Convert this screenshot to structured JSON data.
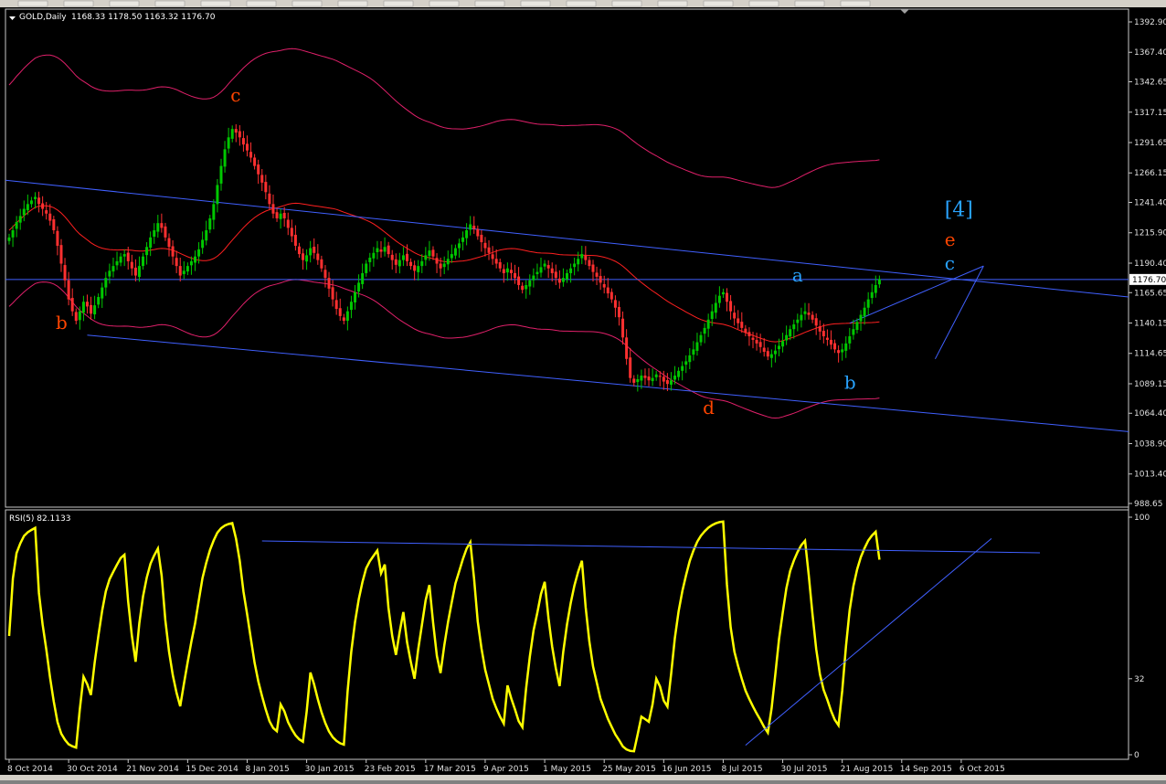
{
  "window": {
    "symbol_header": "GOLD,Daily",
    "ohlc_header": "1168.33 1178.50 1163.32 1176.70",
    "rsi_header": "RSI(5) 82.1133"
  },
  "chart_data": [
    {
      "type": "candlestick",
      "symbol": "GOLD",
      "timeframe": "Daily",
      "ohlc_last": {
        "open": 1168.33,
        "high": 1178.5,
        "low": 1163.32,
        "close": 1176.7
      },
      "ylim": [
        988.65,
        1392.9
      ],
      "y_ticks": [
        "1392.90",
        "1367.40",
        "1342.65",
        "1317.15",
        "1291.65",
        "1266.15",
        "1241.40",
        "1215.90",
        "1190.40",
        "1165.65",
        "1140.15",
        "1114.65",
        "1089.15",
        "1064.40",
        "1038.90",
        "1013.40",
        "988.65"
      ],
      "y_tick_values": [
        1392.9,
        1367.4,
        1342.65,
        1317.15,
        1291.65,
        1266.15,
        1241.4,
        1215.9,
        1190.4,
        1165.65,
        1140.15,
        1114.65,
        1089.15,
        1064.4,
        1038.9,
        1013.4,
        988.65
      ],
      "current_price_label": "1176.70",
      "current_price": 1176.7,
      "x_ticks": [
        "8 Oct 2014",
        "30 Oct 2014",
        "21 Nov 2014",
        "15 Dec 2014",
        "8 Jan 2015",
        "30 Jan 2015",
        "23 Feb 2015",
        "17 Mar 2015",
        "9 Apr 2015",
        "1 May 2015",
        "25 May 2015",
        "16 Jun 2015",
        "8 Jul 2015",
        "30 Jul 2015",
        "21 Aug 2015",
        "14 Sep 2015",
        "6 Oct 2015"
      ],
      "x_tick_index": [
        0,
        16,
        32,
        48,
        64,
        80,
        96,
        112,
        128,
        144,
        160,
        176,
        192,
        208,
        224,
        240,
        256
      ],
      "close_series": [
        1212,
        1218,
        1225,
        1230,
        1236,
        1240,
        1243,
        1246,
        1240,
        1236,
        1232,
        1226,
        1218,
        1205,
        1190,
        1176,
        1160,
        1150,
        1142,
        1150,
        1158,
        1154,
        1148,
        1155,
        1162,
        1170,
        1178,
        1184,
        1188,
        1192,
        1196,
        1198,
        1192,
        1186,
        1180,
        1188,
        1196,
        1204,
        1212,
        1218,
        1224,
        1220,
        1212,
        1204,
        1196,
        1188,
        1180,
        1184,
        1188,
        1192,
        1196,
        1202,
        1210,
        1218,
        1228,
        1240,
        1256,
        1272,
        1286,
        1296,
        1303,
        1300,
        1296,
        1290,
        1285,
        1279,
        1272,
        1265,
        1258,
        1250,
        1240,
        1232,
        1228,
        1232,
        1228,
        1220,
        1213,
        1205,
        1198,
        1193,
        1197,
        1203,
        1199,
        1193,
        1186,
        1178,
        1169,
        1160,
        1152,
        1146,
        1142,
        1150,
        1158,
        1166,
        1174,
        1182,
        1190,
        1195,
        1199,
        1203,
        1200,
        1204,
        1198,
        1193,
        1189,
        1193,
        1197,
        1192,
        1188,
        1184,
        1188,
        1192,
        1197,
        1201,
        1196,
        1190,
        1186,
        1190,
        1194,
        1198,
        1203,
        1207,
        1212,
        1218,
        1223,
        1219,
        1213,
        1208,
        1203,
        1199,
        1194,
        1190,
        1186,
        1182,
        1186,
        1182,
        1178,
        1172,
        1168,
        1172,
        1176,
        1180,
        1183,
        1187,
        1190,
        1186,
        1182,
        1178,
        1174,
        1178,
        1182,
        1186,
        1190,
        1194,
        1198,
        1193,
        1188,
        1183,
        1179,
        1174,
        1170,
        1165,
        1160,
        1153,
        1145,
        1128,
        1110,
        1094,
        1090,
        1093,
        1096,
        1094,
        1092,
        1094,
        1097,
        1095,
        1091,
        1089,
        1092,
        1096,
        1100,
        1104,
        1108,
        1113,
        1118,
        1124,
        1130,
        1136,
        1143,
        1150,
        1157,
        1163,
        1166,
        1158,
        1150,
        1144,
        1140,
        1136,
        1132,
        1129,
        1126,
        1123,
        1120,
        1116,
        1112,
        1114,
        1117,
        1121,
        1125,
        1130,
        1135,
        1139,
        1143,
        1147,
        1150,
        1147,
        1143,
        1138,
        1133,
        1129,
        1126,
        1122,
        1118,
        1115,
        1118,
        1123,
        1129,
        1135,
        1141,
        1147,
        1153,
        1160,
        1166,
        1172,
        1177
      ],
      "wave_labels": [
        {
          "text": "b",
          "color": "#ff4500",
          "i": 14,
          "price": 1135
        },
        {
          "text": "c",
          "color": "#ff4500",
          "i": 61,
          "price": 1326
        },
        {
          "text": "d",
          "color": "#ff4500",
          "i": 188,
          "price": 1064
        },
        {
          "text": "[4]",
          "color": "#29a3ff",
          "i": 253,
          "price": 1230
        },
        {
          "text": "e",
          "color": "#ff4500",
          "i": 253,
          "price": 1205
        },
        {
          "text": "a",
          "color": "#29a3ff",
          "i": 212,
          "price": 1175
        },
        {
          "text": "b",
          "color": "#29a3ff",
          "i": 226,
          "price": 1085
        },
        {
          "text": "c",
          "color": "#29a3ff",
          "i": 253,
          "price": 1185
        }
      ]
    },
    {
      "type": "line",
      "name": "RSI(5) 82.1133",
      "last_value": 82.1133,
      "ylim": [
        0,
        100
      ],
      "y_ticks": [
        "100",
        "32",
        "0"
      ],
      "y_tick_values": [
        100,
        32,
        0
      ],
      "line_color": "#ffff00"
    }
  ],
  "colors": {
    "background": "#000000",
    "bull": "#00c800",
    "bear": "#ff3030",
    "band": "#e0206a",
    "trend": "#4060ff",
    "rsi": "#ffff00",
    "price_tag": "#ffffff"
  }
}
